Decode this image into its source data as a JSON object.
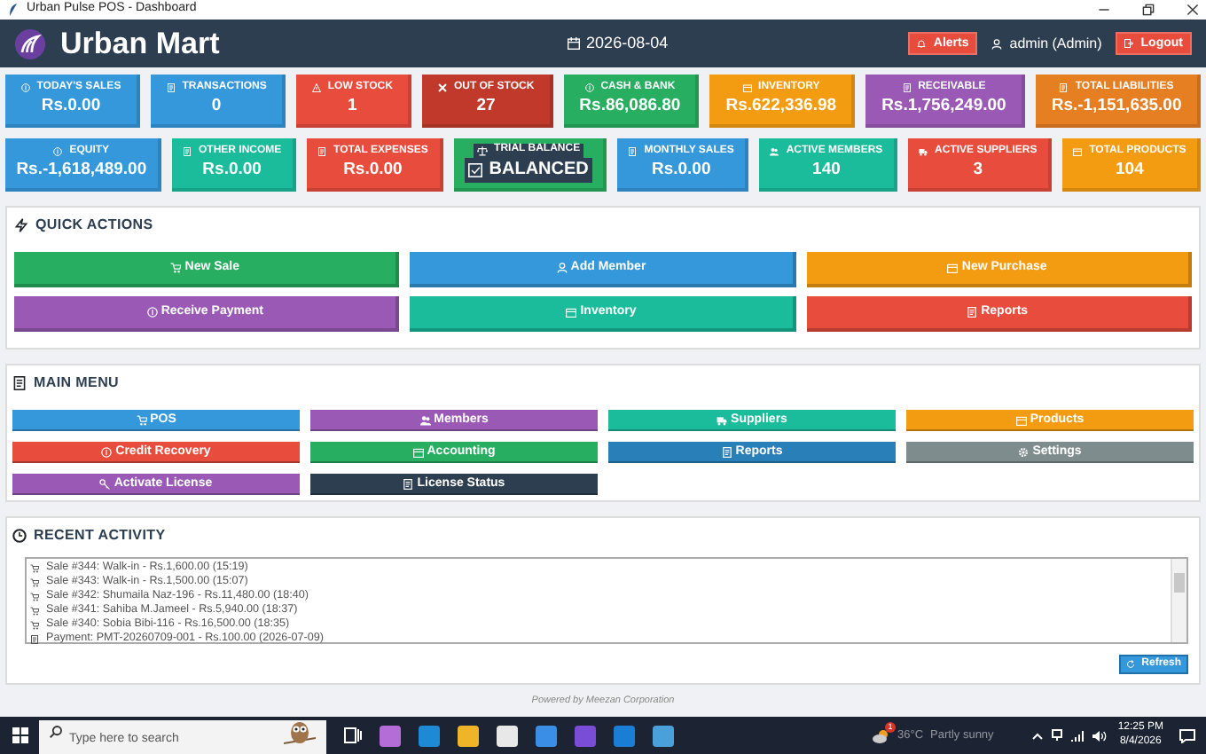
{
  "window": {
    "title": "Urban Pulse POS - Dashboard"
  },
  "header": {
    "app_name": "Urban Mart",
    "date": "2026-08-04",
    "alerts_button": "Alerts",
    "user": "admin (Admin)",
    "logout_button": "Logout"
  },
  "stats": [
    {
      "kind": "amount",
      "label": "TODAY'S SALES",
      "value": "Rs.0.00",
      "color": "#3498db"
    },
    {
      "kind": "amount",
      "label": "TRANSACTIONS",
      "value": "0",
      "color": "#3498db"
    },
    {
      "kind": "amount",
      "label": "LOW STOCK",
      "value": "1",
      "color": "#e74c3c"
    },
    {
      "kind": "amount",
      "label": "OUT OF STOCK",
      "value": "27",
      "color": "#c0392b"
    },
    {
      "kind": "amount",
      "label": "CASH & BANK",
      "value": "Rs.86,086.80",
      "color": "#27ae60"
    },
    {
      "kind": "amount",
      "label": "INVENTORY",
      "value": "Rs.622,336.98",
      "color": "#f39c12"
    },
    {
      "kind": "amount",
      "label": "RECEIVABLE",
      "value": "Rs.1,756,249.00",
      "color": "#9b59b6"
    },
    {
      "kind": "amount",
      "label": "TOTAL LIABILITIES",
      "value": "Rs.-1,151,635.00",
      "color": "#e67e22"
    },
    {
      "kind": "amount",
      "label": "EQUITY",
      "value": "Rs.-1,618,489.00",
      "color": "#3498db"
    },
    {
      "kind": "amount",
      "label": "OTHER INCOME",
      "value": "Rs.0.00",
      "color": "#1abc9c"
    },
    {
      "kind": "amount",
      "label": "TOTAL EXPENSES",
      "value": "Rs.0.00",
      "color": "#e74c3c"
    },
    {
      "kind": "status",
      "label": "TRIAL BALANCE",
      "value": "BALANCED",
      "color": "#27ae60"
    },
    {
      "kind": "amount",
      "label": "MONTHLY SALES",
      "value": "Rs.0.00",
      "color": "#3498db"
    },
    {
      "kind": "amount",
      "label": "ACTIVE MEMBERS",
      "value": "140",
      "color": "#1abc9c"
    },
    {
      "kind": "amount",
      "label": "ACTIVE SUPPLIERS",
      "value": "3",
      "color": "#e74c3c"
    },
    {
      "kind": "amount",
      "label": "TOTAL PRODUCTS",
      "value": "104",
      "color": "#f39c12"
    }
  ],
  "quick_actions": {
    "title": "QUICK ACTIONS",
    "buttons": [
      {
        "label": "New Sale",
        "color": "#27ae60"
      },
      {
        "label": "Add Member",
        "color": "#3498db"
      },
      {
        "label": "New Purchase",
        "color": "#f39c12"
      },
      {
        "label": "Receive Payment",
        "color": "#9b59b6"
      },
      {
        "label": "Inventory",
        "color": "#1abc9c"
      },
      {
        "label": "Reports",
        "color": "#e74c3c"
      }
    ]
  },
  "main_menu": {
    "title": "MAIN MENU",
    "buttons": [
      {
        "label": "POS",
        "color": "#3498db"
      },
      {
        "label": "Members",
        "color": "#9b59b6"
      },
      {
        "label": "Suppliers",
        "color": "#1abc9c"
      },
      {
        "label": "Products",
        "color": "#f39c12"
      },
      {
        "label": "Credit Recovery",
        "color": "#e74c3c"
      },
      {
        "label": "Accounting",
        "color": "#27ae60"
      },
      {
        "label": "Reports",
        "color": "#2980b9"
      },
      {
        "label": "Settings",
        "color": "#7f8c8d"
      },
      {
        "label": "Activate License",
        "color": "#9b59b6"
      },
      {
        "label": "License Status",
        "color": "#2c3e50"
      }
    ]
  },
  "recent_activity": {
    "title": "RECENT ACTIVITY",
    "items": [
      {
        "kind": "sale",
        "text": "Sale #344: Walk-in - Rs.1,600.00 (15:19)"
      },
      {
        "kind": "sale",
        "text": "Sale #343: Walk-in - Rs.1,500.00 (15:07)"
      },
      {
        "kind": "sale",
        "text": "Sale #342: Shumaila Naz-196 - Rs.11,480.00 (18:40)"
      },
      {
        "kind": "sale",
        "text": "Sale #341: Sahiba M.Jameel - Rs.5,940.00 (18:37)"
      },
      {
        "kind": "sale",
        "text": "Sale #340: Sobia Bibi-116 - Rs.16,500.00 (18:35)"
      },
      {
        "kind": "payment",
        "text": "Payment: PMT-20260709-001 - Rs.100.00 (2026-07-09)"
      }
    ],
    "refresh_button": "Refresh"
  },
  "footer": "Powered by Meezan Corporation",
  "taskbar": {
    "search_placeholder": "Type here to search",
    "weather": {
      "badge": "1",
      "temperature": "36°C",
      "condition": "Partly sunny"
    },
    "time": "12:25 PM",
    "date": "8/4/2026"
  }
}
